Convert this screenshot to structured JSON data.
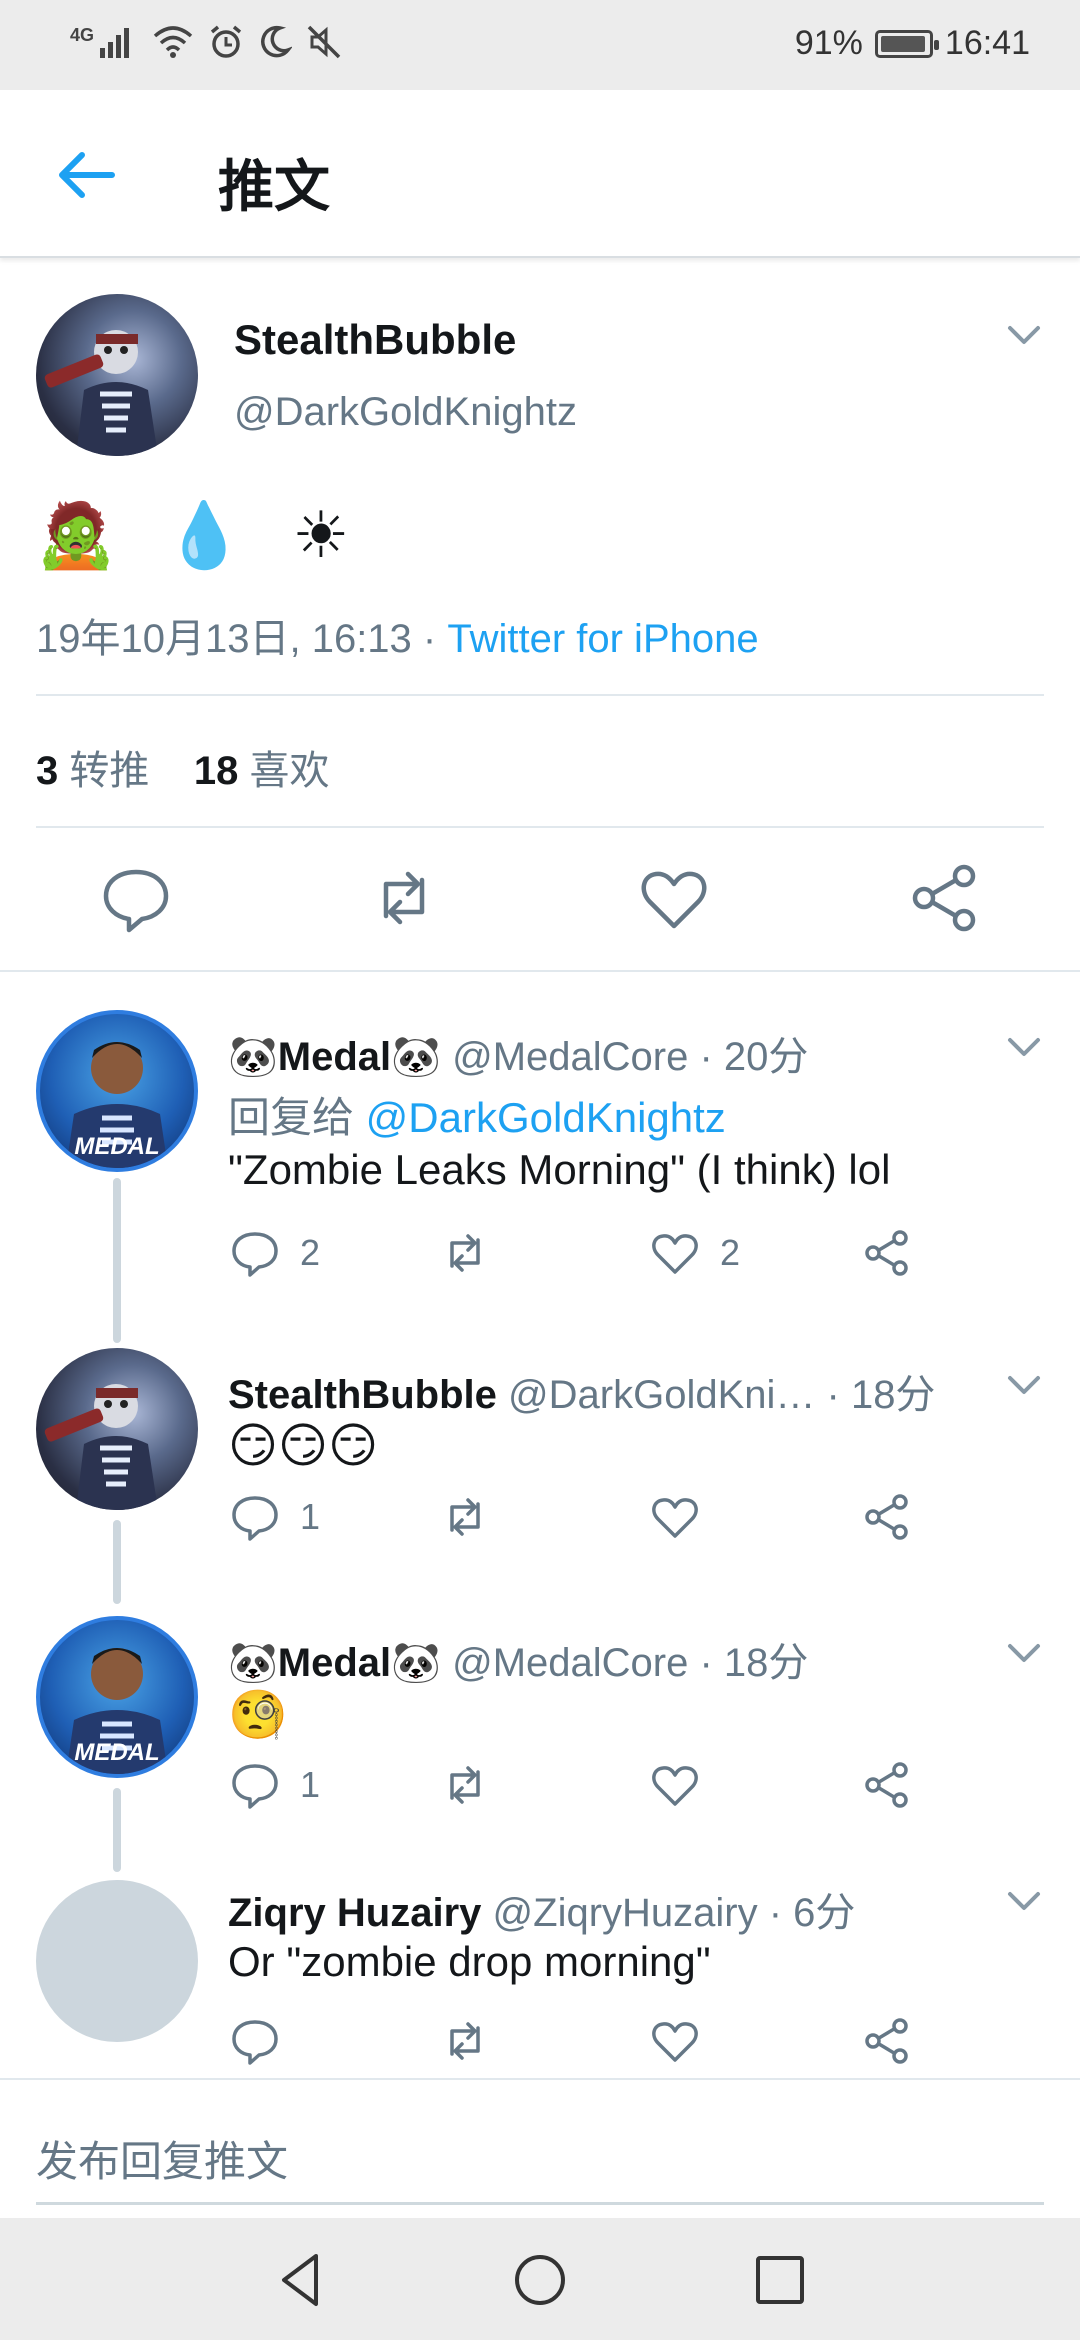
{
  "status_bar": {
    "network": "4G",
    "battery": "91%",
    "battery_level": 0.91,
    "time": "16:41"
  },
  "header": {
    "title": "推文"
  },
  "main_tweet": {
    "name": "StealthBubble",
    "handle": "@DarkGoldKnightz",
    "emoji_text": "🧟 💧 ☀",
    "date": "19年10月13日, 16:13 · ",
    "source": "Twitter for iPhone",
    "retweet_count": "3",
    "retweet_label": "转推",
    "like_count": "18",
    "like_label": "喜欢"
  },
  "replies": [
    {
      "name": "🐼Medal🐼",
      "handle": "@MedalCore · 20分",
      "reply_to_label": "回复给 ",
      "reply_to_handle": "@DarkGoldKnightz",
      "text": "\"Zombie Leaks Morning\" (I think) lol",
      "reply_count": "2",
      "like_count": "2"
    },
    {
      "name": "StealthBubble",
      "handle": "@DarkGoldKni… · 18分",
      "text": "😏😏😏",
      "reply_count": "1"
    },
    {
      "name": "🐼Medal🐼",
      "handle": "@MedalCore · 18分",
      "text": "🧐",
      "reply_count": "1"
    },
    {
      "name": "Ziqry Huzairy",
      "handle": "@ZiqryHuzairy · 6分",
      "text": "Or \"zombie drop morning\""
    }
  ],
  "composer": {
    "placeholder": "发布回复推文"
  }
}
